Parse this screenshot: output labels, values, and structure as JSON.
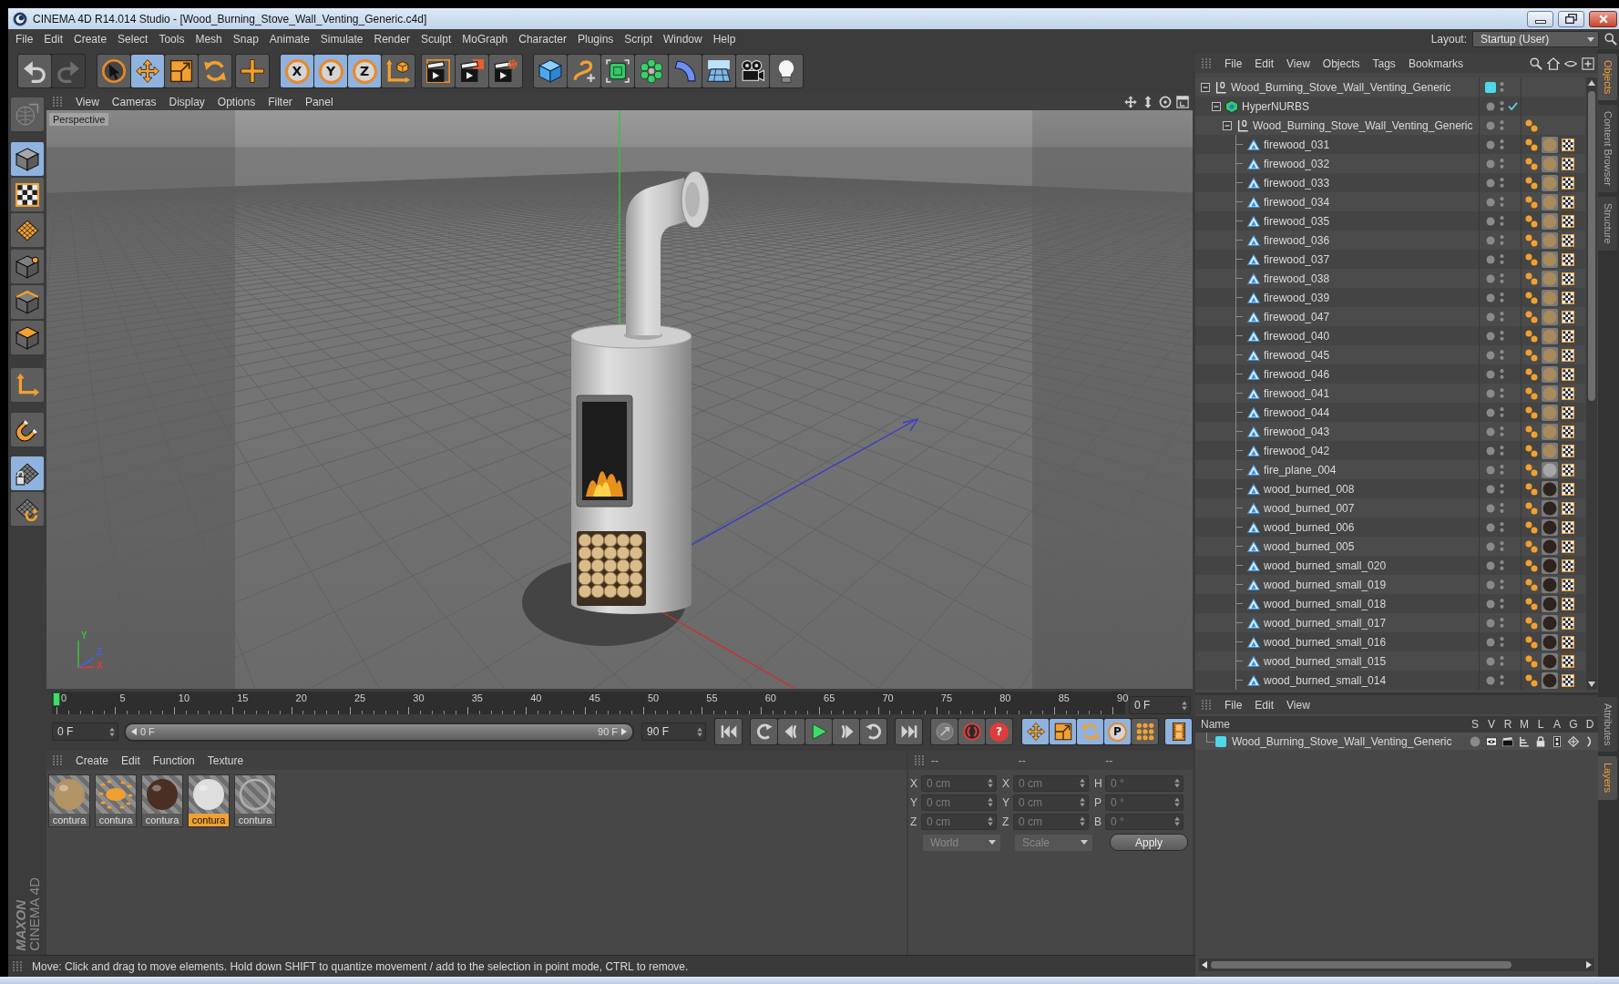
{
  "window": {
    "title": "CINEMA 4D R14.014 Studio - [Wood_Burning_Stove_Wall_Venting_Generic.c4d]"
  },
  "menu_bar": {
    "items": [
      "File",
      "Edit",
      "Create",
      "Select",
      "Tools",
      "Mesh",
      "Snap",
      "Animate",
      "Simulate",
      "Render",
      "Sculpt",
      "MoGraph",
      "Character",
      "Plugins",
      "Script",
      "Window",
      "Help"
    ],
    "layout_label": "Layout:",
    "layout_value": "Startup (User)"
  },
  "toolbar": {
    "groups": [
      [
        {
          "on": false,
          "disabled": false
        },
        {
          "on": false,
          "disabled": true
        }
      ],
      [
        {
          "on": false
        },
        {
          "on": true
        },
        {
          "on": false
        },
        {
          "on": false
        }
      ],
      [
        {
          "on": false
        }
      ],
      [
        {
          "label": "X",
          "on": true
        },
        {
          "label": "Y",
          "on": true
        },
        {
          "label": "Z",
          "on": true
        },
        {
          "on": false
        }
      ],
      [
        {
          "on": false
        },
        {
          "on": false
        },
        {
          "on": false
        }
      ],
      [
        {
          "on": false
        },
        {
          "on": false
        },
        {
          "on": false
        },
        {
          "on": false
        },
        {
          "on": false
        },
        {
          "on": false
        },
        {
          "on": false
        },
        {
          "on": false
        }
      ]
    ]
  },
  "left_toolbar": {
    "groups": [
      [
        {
          "on": false
        }
      ],
      [
        {
          "on": true
        },
        {
          "on": false
        },
        {
          "on": false
        }
      ],
      [
        {
          "on": false
        },
        {
          "on": false
        },
        {
          "on": false
        }
      ],
      [
        {
          "on": false
        }
      ],
      [
        {
          "on": false
        }
      ],
      [
        {
          "on": true
        },
        {
          "on": false
        }
      ]
    ]
  },
  "viewport": {
    "menu": [
      "View",
      "Cameras",
      "Display",
      "Options",
      "Filter",
      "Panel"
    ],
    "camera_label": "Perspective",
    "axis_labels": [
      {
        "label": "Y",
        "color": "#36c236"
      },
      {
        "label": "Z",
        "color": "#4a5cf0"
      },
      {
        "label": "X",
        "color": "#e03a3a"
      }
    ]
  },
  "timeline": {
    "ruler_labels": [
      "0",
      "5",
      "10",
      "15",
      "20",
      "25",
      "30",
      "35",
      "40",
      "45",
      "50",
      "55",
      "60",
      "65",
      "70",
      "75",
      "80",
      "85",
      "90"
    ],
    "playhead": {
      "level": 0
    },
    "current_frame": "0 F",
    "start_field": "0 F",
    "preview_range": {
      "level": 1,
      "start": "0 F",
      "end": "90 F"
    },
    "end_field": "90 F",
    "transport": [
      [
        {
          "on": false
        }
      ],
      [
        {
          "on": false
        },
        {
          "on": false
        },
        {
          "on": false
        },
        {
          "on": false
        },
        {
          "on": false
        }
      ],
      [
        {
          "on": false
        }
      ],
      [
        {
          "on": false
        },
        {
          "on": false
        },
        {
          "label": "?",
          "on": false
        }
      ],
      [
        {
          "on": true
        },
        {
          "on": true
        },
        {
          "on": true
        },
        {
          "label": "P",
          "on": true
        },
        {
          "on": false
        }
      ],
      [
        {
          "on": true
        }
      ]
    ]
  },
  "material_manager": {
    "menu": [
      "Create",
      "Edit",
      "Function",
      "Texture"
    ],
    "materials": [
      {
        "name": "contura",
        "kind": "sphere",
        "color": "#b39466",
        "selected": false
      },
      {
        "name": "contura",
        "kind": "speckled",
        "color": "#f0a030",
        "selected": false
      },
      {
        "name": "contura",
        "kind": "sphere",
        "color": "#4a2f25",
        "selected": false
      },
      {
        "name": "contura",
        "kind": "sphere",
        "color": "#dedede",
        "selected": true
      },
      {
        "name": "contura",
        "kind": "clear",
        "color": "#b0b0b0",
        "selected": false
      }
    ]
  },
  "coordinates": {
    "disabled": true,
    "headers": [
      "--",
      "--",
      "--"
    ],
    "rows": [
      {
        "axes": [
          "X",
          "X",
          "H"
        ],
        "values": [
          "0 cm",
          "0 cm",
          "0 °"
        ]
      },
      {
        "axes": [
          "Y",
          "Y",
          "P"
        ],
        "values": [
          "0 cm",
          "0 cm",
          "0 °"
        ]
      },
      {
        "axes": [
          "Z",
          "Z",
          "B"
        ],
        "values": [
          "0 cm",
          "0 cm",
          "0 °"
        ]
      }
    ],
    "dropdowns": [
      "World",
      "Scale"
    ],
    "apply": "Apply"
  },
  "logo": {
    "brand": "MAXON",
    "product": "CINEMA 4D"
  },
  "status_bar": {
    "text": "Move: Click and drag to move elements. Hold down SHIFT to quantize movement / add to the selection in point mode, CTRL to remove."
  },
  "object_manager": {
    "menu": [
      "File",
      "Edit",
      "View",
      "Objects",
      "Tags",
      "Bookmarks"
    ],
    "tree": [
      {
        "name": "Wood_Burning_Stove_Wall_Venting_Generic",
        "kind": "null",
        "selected": false,
        "expanded": true,
        "color": "#4fd8e8",
        "children": [
          {
            "name": "HyperNURBS",
            "kind": "nurbs",
            "selected": false,
            "expanded": true,
            "enabled": true,
            "children": [
              {
                "name": "Wood_Burning_Stove_Wall_Venting_Generic",
                "kind": "null",
                "selected": false,
                "expanded": true,
                "tags": [
                  {
                    "kind": "phong"
                  }
                ],
                "children": [
                  {
                    "name": "firewood_031",
                    "kind": "polygon",
                    "selected": false,
                    "tags": [
                      {
                        "kind": "phong"
                      },
                      {
                        "kind": "texture",
                        "color": "#a88a5c"
                      },
                      {
                        "kind": "uvw"
                      }
                    ]
                  },
                  {
                    "name": "firewood_032",
                    "kind": "polygon",
                    "selected": false,
                    "tags": [
                      {
                        "kind": "phong"
                      },
                      {
                        "kind": "texture",
                        "color": "#a88a5c"
                      },
                      {
                        "kind": "uvw"
                      }
                    ]
                  },
                  {
                    "name": "firewood_033",
                    "kind": "polygon",
                    "selected": false,
                    "tags": [
                      {
                        "kind": "phong"
                      },
                      {
                        "kind": "texture",
                        "color": "#a88a5c"
                      },
                      {
                        "kind": "uvw"
                      }
                    ]
                  },
                  {
                    "name": "firewood_034",
                    "kind": "polygon",
                    "selected": false,
                    "tags": [
                      {
                        "kind": "phong"
                      },
                      {
                        "kind": "texture",
                        "color": "#a88a5c"
                      },
                      {
                        "kind": "uvw"
                      }
                    ]
                  },
                  {
                    "name": "firewood_035",
                    "kind": "polygon",
                    "selected": false,
                    "tags": [
                      {
                        "kind": "phong"
                      },
                      {
                        "kind": "texture",
                        "color": "#a88a5c"
                      },
                      {
                        "kind": "uvw"
                      }
                    ]
                  },
                  {
                    "name": "firewood_036",
                    "kind": "polygon",
                    "selected": false,
                    "tags": [
                      {
                        "kind": "phong"
                      },
                      {
                        "kind": "texture",
                        "color": "#a88a5c"
                      },
                      {
                        "kind": "uvw"
                      }
                    ]
                  },
                  {
                    "name": "firewood_037",
                    "kind": "polygon",
                    "selected": false,
                    "tags": [
                      {
                        "kind": "phong"
                      },
                      {
                        "kind": "texture",
                        "color": "#a88a5c"
                      },
                      {
                        "kind": "uvw"
                      }
                    ]
                  },
                  {
                    "name": "firewood_038",
                    "kind": "polygon",
                    "selected": false,
                    "tags": [
                      {
                        "kind": "phong"
                      },
                      {
                        "kind": "texture",
                        "color": "#a88a5c"
                      },
                      {
                        "kind": "uvw"
                      }
                    ]
                  },
                  {
                    "name": "firewood_039",
                    "kind": "polygon",
                    "selected": false,
                    "tags": [
                      {
                        "kind": "phong"
                      },
                      {
                        "kind": "texture",
                        "color": "#a88a5c"
                      },
                      {
                        "kind": "uvw"
                      }
                    ]
                  },
                  {
                    "name": "firewood_047",
                    "kind": "polygon",
                    "selected": false,
                    "tags": [
                      {
                        "kind": "phong"
                      },
                      {
                        "kind": "texture",
                        "color": "#a88a5c"
                      },
                      {
                        "kind": "uvw"
                      }
                    ]
                  },
                  {
                    "name": "firewood_040",
                    "kind": "polygon",
                    "selected": false,
                    "tags": [
                      {
                        "kind": "phong"
                      },
                      {
                        "kind": "texture",
                        "color": "#a88a5c"
                      },
                      {
                        "kind": "uvw"
                      }
                    ]
                  },
                  {
                    "name": "firewood_045",
                    "kind": "polygon",
                    "selected": false,
                    "tags": [
                      {
                        "kind": "phong"
                      },
                      {
                        "kind": "texture",
                        "color": "#a88a5c"
                      },
                      {
                        "kind": "uvw"
                      }
                    ]
                  },
                  {
                    "name": "firewood_046",
                    "kind": "polygon",
                    "selected": false,
                    "tags": [
                      {
                        "kind": "phong"
                      },
                      {
                        "kind": "texture",
                        "color": "#a88a5c"
                      },
                      {
                        "kind": "uvw"
                      }
                    ]
                  },
                  {
                    "name": "firewood_041",
                    "kind": "polygon",
                    "selected": false,
                    "tags": [
                      {
                        "kind": "phong"
                      },
                      {
                        "kind": "texture",
                        "color": "#a88a5c"
                      },
                      {
                        "kind": "uvw"
                      }
                    ]
                  },
                  {
                    "name": "firewood_044",
                    "kind": "polygon",
                    "selected": false,
                    "tags": [
                      {
                        "kind": "phong"
                      },
                      {
                        "kind": "texture",
                        "color": "#a88a5c"
                      },
                      {
                        "kind": "uvw"
                      }
                    ]
                  },
                  {
                    "name": "firewood_043",
                    "kind": "polygon",
                    "selected": false,
                    "tags": [
                      {
                        "kind": "phong"
                      },
                      {
                        "kind": "texture",
                        "color": "#a88a5c"
                      },
                      {
                        "kind": "uvw"
                      }
                    ]
                  },
                  {
                    "name": "firewood_042",
                    "kind": "polygon",
                    "selected": false,
                    "tags": [
                      {
                        "kind": "phong"
                      },
                      {
                        "kind": "texture",
                        "color": "#a88a5c"
                      },
                      {
                        "kind": "uvw"
                      }
                    ]
                  },
                  {
                    "name": "fire_plane_004",
                    "kind": "polygon",
                    "selected": false,
                    "tags": [
                      {
                        "kind": "phong"
                      },
                      {
                        "kind": "texture",
                        "color": "#a6a6a6"
                      },
                      {
                        "kind": "uvw"
                      }
                    ]
                  },
                  {
                    "name": "wood_burned_008",
                    "kind": "polygon",
                    "selected": false,
                    "tags": [
                      {
                        "kind": "phong"
                      },
                      {
                        "kind": "texture",
                        "color": "#2e231e"
                      },
                      {
                        "kind": "uvw"
                      }
                    ]
                  },
                  {
                    "name": "wood_burned_007",
                    "kind": "polygon",
                    "selected": false,
                    "tags": [
                      {
                        "kind": "phong"
                      },
                      {
                        "kind": "texture",
                        "color": "#2e231e"
                      },
                      {
                        "kind": "uvw"
                      }
                    ]
                  },
                  {
                    "name": "wood_burned_006",
                    "kind": "polygon",
                    "selected": false,
                    "tags": [
                      {
                        "kind": "phong"
                      },
                      {
                        "kind": "texture",
                        "color": "#2e231e"
                      },
                      {
                        "kind": "uvw"
                      }
                    ]
                  },
                  {
                    "name": "wood_burned_005",
                    "kind": "polygon",
                    "selected": false,
                    "tags": [
                      {
                        "kind": "phong"
                      },
                      {
                        "kind": "texture",
                        "color": "#2e231e"
                      },
                      {
                        "kind": "uvw"
                      }
                    ]
                  },
                  {
                    "name": "wood_burned_small_020",
                    "kind": "polygon",
                    "selected": false,
                    "tags": [
                      {
                        "kind": "phong"
                      },
                      {
                        "kind": "texture",
                        "color": "#2e231e"
                      },
                      {
                        "kind": "uvw"
                      }
                    ]
                  },
                  {
                    "name": "wood_burned_small_019",
                    "kind": "polygon",
                    "selected": false,
                    "tags": [
                      {
                        "kind": "phong"
                      },
                      {
                        "kind": "texture",
                        "color": "#2e231e"
                      },
                      {
                        "kind": "uvw"
                      }
                    ]
                  },
                  {
                    "name": "wood_burned_small_018",
                    "kind": "polygon",
                    "selected": false,
                    "tags": [
                      {
                        "kind": "phong"
                      },
                      {
                        "kind": "texture",
                        "color": "#2e231e"
                      },
                      {
                        "kind": "uvw"
                      }
                    ]
                  },
                  {
                    "name": "wood_burned_small_017",
                    "kind": "polygon",
                    "selected": false,
                    "tags": [
                      {
                        "kind": "phong"
                      },
                      {
                        "kind": "texture",
                        "color": "#2e231e"
                      },
                      {
                        "kind": "uvw"
                      }
                    ]
                  },
                  {
                    "name": "wood_burned_small_016",
                    "kind": "polygon",
                    "selected": false,
                    "tags": [
                      {
                        "kind": "phong"
                      },
                      {
                        "kind": "texture",
                        "color": "#2e231e"
                      },
                      {
                        "kind": "uvw"
                      }
                    ]
                  },
                  {
                    "name": "wood_burned_small_015",
                    "kind": "polygon",
                    "selected": false,
                    "tags": [
                      {
                        "kind": "phong"
                      },
                      {
                        "kind": "texture",
                        "color": "#2e231e"
                      },
                      {
                        "kind": "uvw"
                      }
                    ]
                  },
                  {
                    "name": "wood_burned_small_014",
                    "kind": "polygon",
                    "selected": false,
                    "tags": [
                      {
                        "kind": "phong"
                      },
                      {
                        "kind": "texture",
                        "color": "#2e231e"
                      },
                      {
                        "kind": "uvw"
                      }
                    ]
                  }
                ]
              }
            ]
          }
        ]
      }
    ]
  },
  "layer_manager": {
    "menu": [
      "File",
      "Edit",
      "View"
    ],
    "columns": [
      "Name",
      "S",
      "V",
      "R",
      "M",
      "L",
      "A",
      "G",
      "D"
    ],
    "layers": [
      {
        "name": "Wood_Burning_Stove_Wall_Venting_Generic",
        "color": "#4fd8e8",
        "selected": false
      }
    ]
  },
  "side_tabs": {
    "upper": [
      {
        "label": "Objects",
        "selected": true
      },
      {
        "label": "Content Browser",
        "selected": false
      },
      {
        "label": "Structure",
        "selected": false
      }
    ],
    "lower": [
      {
        "label": "Attributes",
        "selected": false
      },
      {
        "label": "Layers",
        "selected": true
      }
    ]
  }
}
